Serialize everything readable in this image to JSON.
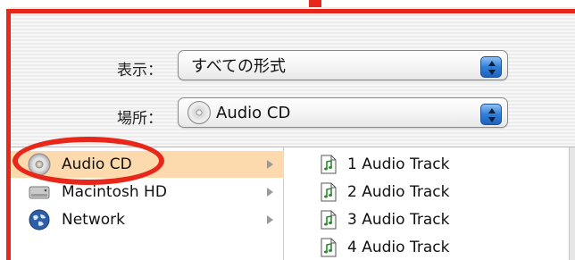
{
  "dialog": {
    "show_label": "表示：",
    "show_value": "すべての形式",
    "location_label": "場所：",
    "location_value": "Audio CD"
  },
  "sidebar": {
    "items": [
      {
        "label": "Audio CD",
        "icon": "cd-icon",
        "selected": true
      },
      {
        "label": "Macintosh HD",
        "icon": "hard-drive-icon",
        "selected": false
      },
      {
        "label": "Network",
        "icon": "network-globe-icon",
        "selected": false
      }
    ]
  },
  "tracks": [
    {
      "label": "1 Audio Track",
      "icon": "audio-file-icon"
    },
    {
      "label": "2 Audio Track",
      "icon": "audio-file-icon"
    },
    {
      "label": "3 Audio Track",
      "icon": "audio-file-icon"
    },
    {
      "label": "4 Audio Track",
      "icon": "audio-file-icon"
    }
  ],
  "annotation": {
    "highlight_color": "#e8271a",
    "selection_color": "#fdd9ae"
  }
}
